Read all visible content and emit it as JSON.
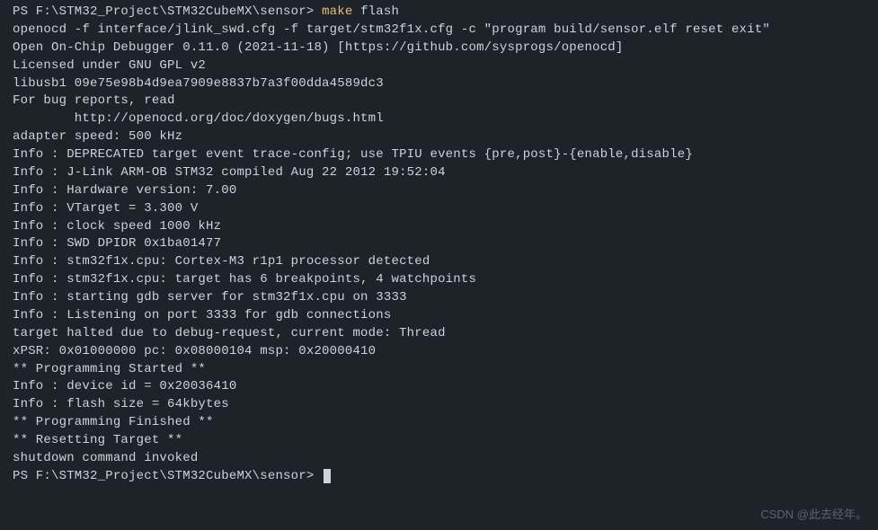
{
  "prompt1": {
    "path": "PS F:\\STM32_Project\\STM32CubeMX\\sensor> ",
    "cmd_highlight": "make",
    "cmd_rest": " flash"
  },
  "output": [
    "openocd -f interface/jlink_swd.cfg -f target/stm32f1x.cfg -c \"program build/sensor.elf reset exit\"",
    "Open On-Chip Debugger 0.11.0 (2021-11-18) [https://github.com/sysprogs/openocd]",
    "Licensed under GNU GPL v2",
    "libusb1 09e75e98b4d9ea7909e8837b7a3f00dda4589dc3",
    "For bug reports, read",
    "        http://openocd.org/doc/doxygen/bugs.html",
    "adapter speed: 500 kHz",
    "",
    "Info : DEPRECATED target event trace-config; use TPIU events {pre,post}-{enable,disable}",
    "Info : J-Link ARM-OB STM32 compiled Aug 22 2012 19:52:04",
    "Info : Hardware version: 7.00",
    "Info : VTarget = 3.300 V",
    "Info : clock speed 1000 kHz",
    "Info : SWD DPIDR 0x1ba01477",
    "Info : stm32f1x.cpu: Cortex-M3 r1p1 processor detected",
    "Info : stm32f1x.cpu: target has 6 breakpoints, 4 watchpoints",
    "Info : starting gdb server for stm32f1x.cpu on 3333",
    "Info : Listening on port 3333 for gdb connections",
    "target halted due to debug-request, current mode: Thread",
    "xPSR: 0x01000000 pc: 0x08000104 msp: 0x20000410",
    "** Programming Started **",
    "Info : device id = 0x20036410",
    "Info : flash size = 64kbytes",
    "** Programming Finished **",
    "** Resetting Target **",
    "shutdown command invoked"
  ],
  "prompt2": {
    "path": "PS F:\\STM32_Project\\STM32CubeMX\\sensor> "
  },
  "watermark": "CSDN @此去经年。"
}
